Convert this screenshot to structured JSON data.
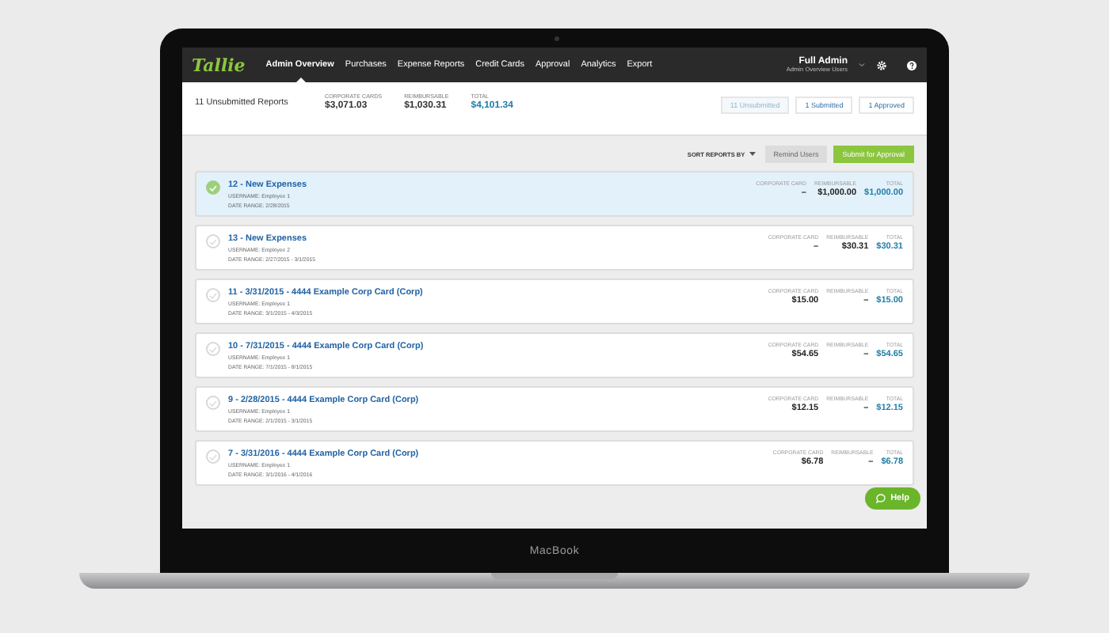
{
  "device": {
    "label": "MacBook"
  },
  "navbar": {
    "logo": "Tallie",
    "items": [
      {
        "label": "Admin Overview",
        "selected": true
      },
      {
        "label": "Purchases",
        "selected": false
      },
      {
        "label": "Expense Reports",
        "selected": false
      },
      {
        "label": "Credit Cards",
        "selected": false
      },
      {
        "label": "Approval",
        "selected": false
      },
      {
        "label": "Analytics",
        "selected": false
      },
      {
        "label": "Export",
        "selected": false
      }
    ],
    "user": {
      "name": "Full Admin",
      "role": "Admin Overview Users"
    }
  },
  "summary": {
    "title": "11 Unsubmitted Reports",
    "stats": [
      {
        "label": "CORPORATE CARDS",
        "value": "$3,071.03",
        "kind": "plain"
      },
      {
        "label": "REIMBURSABLE",
        "value": "$1,030.31",
        "kind": "plain"
      },
      {
        "label": "TOTAL",
        "value": "$4,101.34",
        "kind": "total"
      }
    ],
    "filters": [
      {
        "label": "11 Unsubmitted",
        "selected": true
      },
      {
        "label": "1 Submitted",
        "selected": false
      },
      {
        "label": "1 Approved",
        "selected": false
      }
    ]
  },
  "toolbar": {
    "sort_label": "SORT REPORTS BY",
    "remind": "Remind Users",
    "submit": "Submit for Approval"
  },
  "reports": [
    {
      "title": "12 - New Expenses",
      "username": "USERNAME: Employee 1",
      "date_range": "DATE RANGE: 2/28/2015",
      "column_labels": [
        "CORPORATE CARD",
        "REIMBURSABLE",
        "TOTAL"
      ],
      "corporate": "–",
      "reimbursable": "$1,000.00",
      "total": "$1,000.00",
      "selected": true
    },
    {
      "title": "13 - New Expenses",
      "username": "USERNAME: Employee 2",
      "date_range": "DATE RANGE: 2/27/2015 - 3/1/2015",
      "column_labels": [
        "CORPORATE CARD",
        "REIMBURSABLE",
        "TOTAL"
      ],
      "corporate": "–",
      "reimbursable": "$30.31",
      "total": "$30.31",
      "selected": false
    },
    {
      "title": "11 - 3/31/2015 - 4444 Example Corp Card (Corp)",
      "username": "USERNAME: Employee 1",
      "date_range": "DATE RANGE: 3/1/2015 - 4/3/2015",
      "column_labels": [
        "CORPORATE CARD",
        "REIMBURSABLE",
        "TOTAL"
      ],
      "corporate": "$15.00",
      "reimbursable": "–",
      "total": "$15.00",
      "selected": false
    },
    {
      "title": "10 - 7/31/2015 - 4444 Example Corp Card (Corp)",
      "username": "USERNAME: Employee 1",
      "date_range": "DATE RANGE: 7/1/2015 - 8/1/2015",
      "column_labels": [
        "CORPORATE CARD",
        "REIMBURSABLE",
        "TOTAL"
      ],
      "corporate": "$54.65",
      "reimbursable": "–",
      "total": "$54.65",
      "selected": false
    },
    {
      "title": "9 - 2/28/2015 - 4444 Example Corp Card (Corp)",
      "username": "USERNAME: Employee 1",
      "date_range": "DATE RANGE: 2/1/2015 - 3/1/2015",
      "column_labels": [
        "CORPORATE CARD",
        "REIMBURSABLE",
        "TOTAL"
      ],
      "corporate": "$12.15",
      "reimbursable": "–",
      "total": "$12.15",
      "selected": false
    },
    {
      "title": "7 - 3/31/2016 - 4444 Example Corp Card (Corp)",
      "username": "USERNAME: Employee 1",
      "date_range": "DATE RANGE: 3/1/2016 - 4/1/2016",
      "column_labels": [
        "CORPORATE CARD",
        "REIMBURSABLE",
        "TOTAL"
      ],
      "corporate": "$6.78",
      "reimbursable": "–",
      "total": "$6.78",
      "selected": false
    }
  ],
  "help": {
    "label": "Help"
  }
}
